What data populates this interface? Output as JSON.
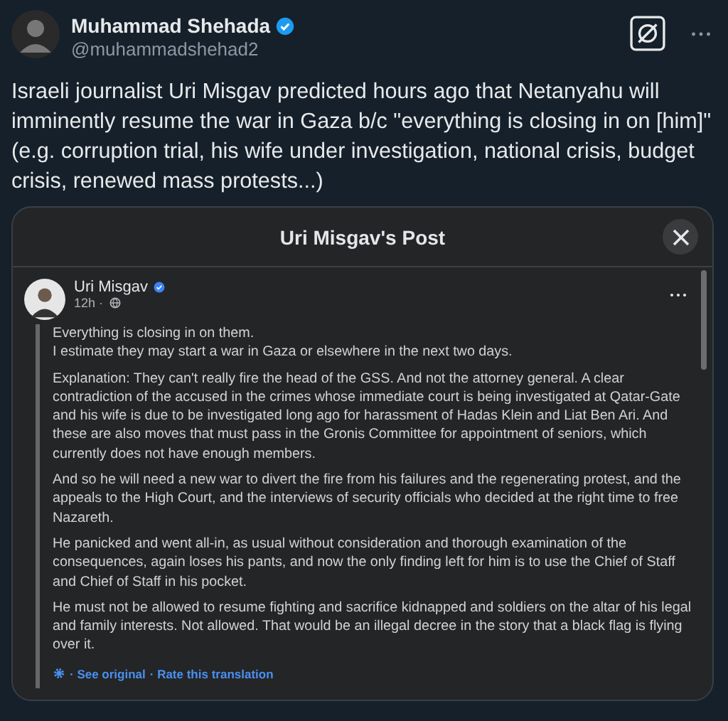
{
  "author": {
    "name": "Muhammad Shehada",
    "handle": "@muhammadshehad2",
    "verified": true
  },
  "tweet_text": "Israeli journalist Uri Misgav predicted hours ago that Netanyahu will imminently resume the war in Gaza b/c \"everything is closing in on [him]\" (e.g. corruption trial, his wife under investigation, national crisis, budget crisis, renewed mass protests...)",
  "embedded_post": {
    "title": "Uri Misgav's Post",
    "author": "Uri Misgav",
    "verified": true,
    "time": "12h ·",
    "paragraphs": [
      "Everything is closing in on them.\nI estimate they may start a war in Gaza or elsewhere in the next two days.",
      "Explanation: They can't really fire the head of the GSS. And not the attorney general. A clear contradiction of the accused in the crimes whose immediate court is being investigated at Qatar-Gate and his wife is due to be investigated long ago for harassment of Hadas Klein and Liat Ben Ari. And these are also moves that must pass in the Gronis Committee for appointment of seniors, which currently does not have enough members.",
      "And so he will need a new war to divert the fire from his failures and the regenerating protest, and the appeals to the High Court, and the interviews of security officials who decided at the right time to free Nazareth.",
      "He panicked and went all-in, as usual without consideration and thorough examination of the consequences, again loses his pants, and now the only finding left for him is to use the Chief of Staff and Chief of Staff in his pocket.",
      "He must not be allowed to resume fighting and sacrifice kidnapped and soldiers on the altar of his legal and family interests. Not allowed. That would be an illegal decree in the story that a black flag is flying over it."
    ],
    "links": [
      "· See original",
      "· Rate this translation"
    ]
  }
}
